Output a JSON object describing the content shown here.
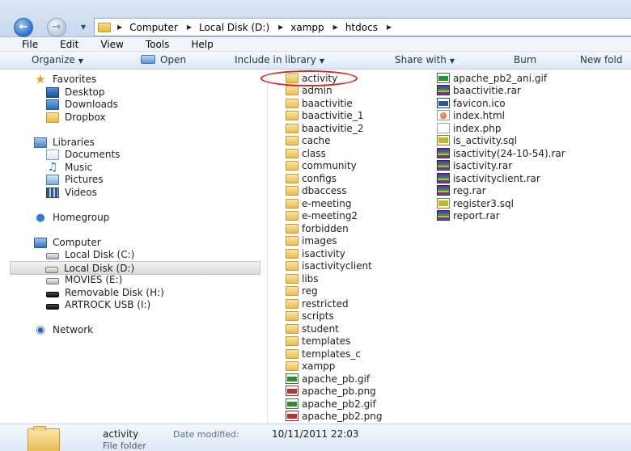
{
  "address": {
    "crumbs": [
      "Computer",
      "Local Disk (D:)",
      "xampp",
      "htdocs"
    ]
  },
  "menubar": [
    "File",
    "Edit",
    "View",
    "Tools",
    "Help"
  ],
  "toolbar": {
    "organize": "Organize",
    "open": "Open",
    "include_in_library": "Include in library",
    "share_with": "Share with",
    "burn": "Burn",
    "new_folder": "New fold"
  },
  "nav": {
    "favorites": "Favorites",
    "desktop": "Desktop",
    "downloads": "Downloads",
    "dropbox": "Dropbox",
    "libraries": "Libraries",
    "documents": "Documents",
    "music": "Music",
    "pictures": "Pictures",
    "videos": "Videos",
    "homegroup": "Homegroup",
    "computer": "Computer",
    "local_c": "Local Disk (C:)",
    "local_d": "Local Disk (D:)",
    "movies_e": "MOVIES (E:)",
    "removable_h": "Removable Disk (H:)",
    "artrock_i": "ARTROCK USB (I:)",
    "network": "Network"
  },
  "files_col1": [
    "activity",
    "admin",
    "baactivitie",
    "baactivitie_1",
    "baactivitie_2",
    "cache",
    "class",
    "community",
    "configs",
    "dbaccess",
    "e-meeting",
    "e-meeting2",
    "forbidden",
    "images",
    "isactivity",
    "isactivityclient",
    "libs",
    "reg",
    "restricted",
    "scripts",
    "student",
    "templates",
    "templates_c",
    "xampp",
    "apache_pb.gif",
    "apache_pb.png",
    "apache_pb2.gif",
    "apache_pb2.png"
  ],
  "files_col2": [
    "apache_pb2_ani.gif",
    "baactivitie.rar",
    "favicon.ico",
    "index.html",
    "index.php",
    "is_activity.sql",
    "isactivity(24-10-54).rar",
    "isactivity.rar",
    "isactivityclient.rar",
    "reg.rar",
    "register3.sql",
    "report.rar"
  ],
  "details": {
    "name": "activity",
    "type": "File folder",
    "modified_label": "Date modified:",
    "modified_value": "10/11/2011 22:03"
  }
}
